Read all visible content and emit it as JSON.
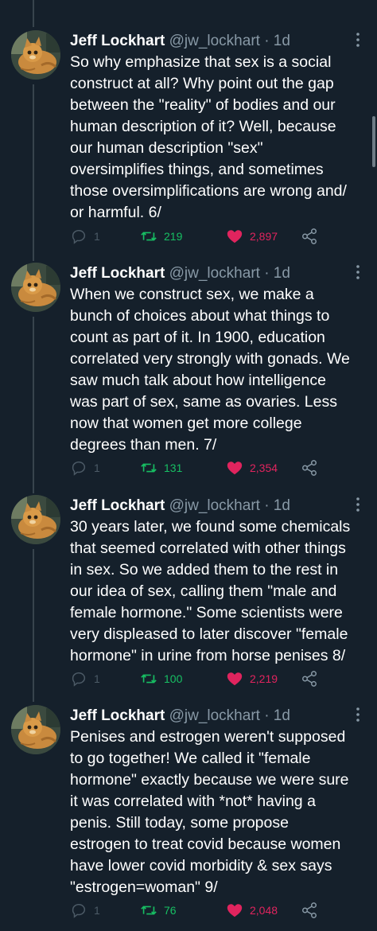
{
  "colors": {
    "background": "#15202b",
    "text": "#ffffff",
    "muted": "#8899a6",
    "reply": "#4c5a66",
    "retweet": "#17bf63",
    "like": "#e0245e"
  },
  "tweets": [
    {
      "author_name": "Jeff Lockhart",
      "author_handle": "@jw_lockhart",
      "time": "· 1d",
      "text": "So why emphasize that sex is a social\nconstruct at all? Why point out the gap\nbetween the \"reality\" of bodies and our\nhuman description of it? Well, because\nour human description \"sex\"\noversimplifies things, and sometimes\nthose oversimplifications are wrong and/\nor harmful. 6/",
      "replies": "1",
      "retweets": "219",
      "likes": "2,897"
    },
    {
      "author_name": "Jeff Lockhart",
      "author_handle": "@jw_lockhart",
      "time": "· 1d",
      "text": "When we construct sex, we make a\nbunch of choices about what things to\ncount as part of it. In 1900, education\ncorrelated very strongly with gonads. We\nsaw much talk about how intelligence\nwas part of sex, same as ovaries. Less\nnow that women get more college\ndegrees than men. 7/",
      "replies": "1",
      "retweets": "131",
      "likes": "2,354"
    },
    {
      "author_name": "Jeff Lockhart",
      "author_handle": "@jw_lockhart",
      "time": "· 1d",
      "text": "30 years later, we found some chemicals\nthat seemed correlated with other things\nin sex. So we added them to the rest in\nour idea of sex, calling them \"male and\nfemale hormone.\" Some scientists were\nvery displeased to later discover \"female\nhormone\" in urine from horse penises 8/",
      "replies": "1",
      "retweets": "100",
      "likes": "2,219"
    },
    {
      "author_name": "Jeff Lockhart",
      "author_handle": "@jw_lockhart",
      "time": "· 1d",
      "text": "Penises and estrogen weren't supposed\nto go together! We called it \"female\nhormone\" exactly because we were sure\nit was correlated with *not* having a\npenis. Still today, some propose\nestrogen to treat covid because women\nhave lower covid morbidity & sex says\n\"estrogen=woman\" 9/",
      "replies": "1",
      "retweets": "76",
      "likes": "2,048"
    }
  ]
}
